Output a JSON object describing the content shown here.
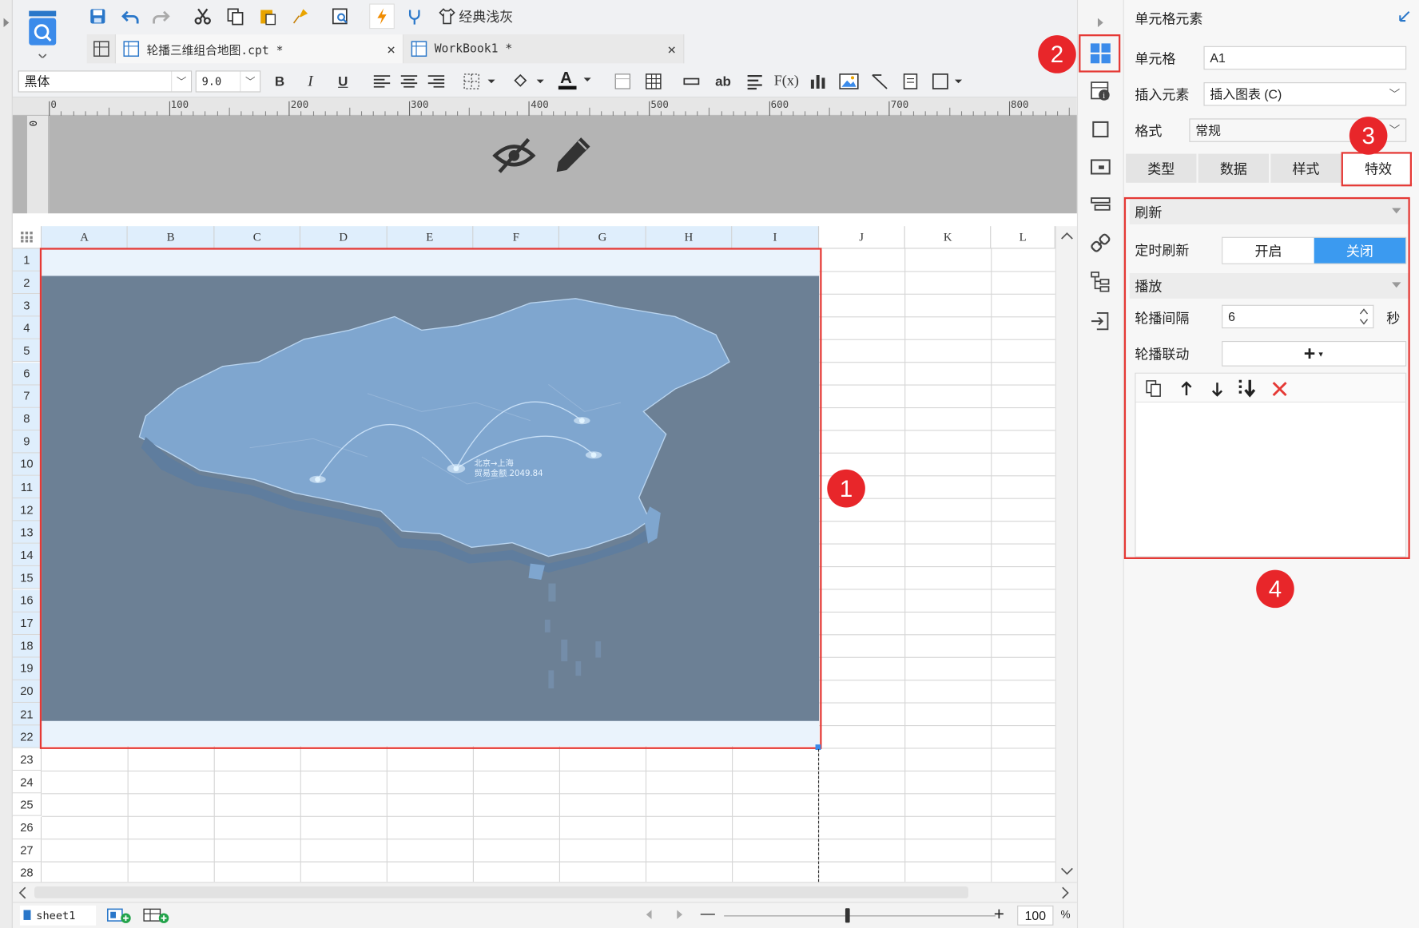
{
  "toolbar": {
    "classic_theme_label": "经典浅灰",
    "font_name": "黑体",
    "font_size": "9.0",
    "bold": "B",
    "italic": "I",
    "underline": "U",
    "text_ab": "ab",
    "formula_label": "F(x)"
  },
  "tabs": [
    {
      "label": "轮播三维组合地图.cpt *",
      "close": "×"
    },
    {
      "label": "WorkBook1 *",
      "close": "×"
    }
  ],
  "ruler": {
    "marks": [
      "0",
      "100",
      "200",
      "300",
      "400",
      "500",
      "600",
      "700",
      "800"
    ],
    "v_mark": "0"
  },
  "columns": [
    "A",
    "B",
    "C",
    "D",
    "E",
    "F",
    "G",
    "H",
    "I",
    "J",
    "K",
    "L"
  ],
  "rows": [
    "1",
    "2",
    "3",
    "4",
    "5",
    "6",
    "7",
    "8",
    "9",
    "10",
    "11",
    "12",
    "13",
    "14",
    "15",
    "16",
    "17",
    "18",
    "19",
    "20",
    "21",
    "22",
    "23",
    "24",
    "25",
    "26",
    "27",
    "28"
  ],
  "map": {
    "label_line1": "北京→上海",
    "label_line2": "贸易金额 2049.84"
  },
  "bottom": {
    "sheet_name": "sheet1",
    "zoom_value": "100",
    "zoom_unit": "%",
    "minus": "—",
    "plus": "+"
  },
  "panel": {
    "title": "单元格元素",
    "cell_label": "单元格",
    "cell_value": "A1",
    "insert_label": "插入元素",
    "insert_value": "插入图表 (C)",
    "format_label": "格式",
    "format_value": "常规",
    "tabs": [
      "类型",
      "数据",
      "样式",
      "特效"
    ],
    "refresh_section": "刷新",
    "timed_refresh_label": "定时刷新",
    "toggle_on": "开启",
    "toggle_off": "关闭",
    "play_section": "播放",
    "interval_label": "轮播间隔",
    "interval_value": "6",
    "interval_unit": "秒",
    "linkage_label": "轮播联动",
    "linkage_add": "+"
  },
  "badges": [
    "1",
    "2",
    "3",
    "4"
  ],
  "colors": {
    "accent": "#3b8bea",
    "highlight": "#e53935",
    "map_bg": "#6c8095",
    "map_land": "#7fa6cf",
    "col_selected": "#dfeefc"
  }
}
